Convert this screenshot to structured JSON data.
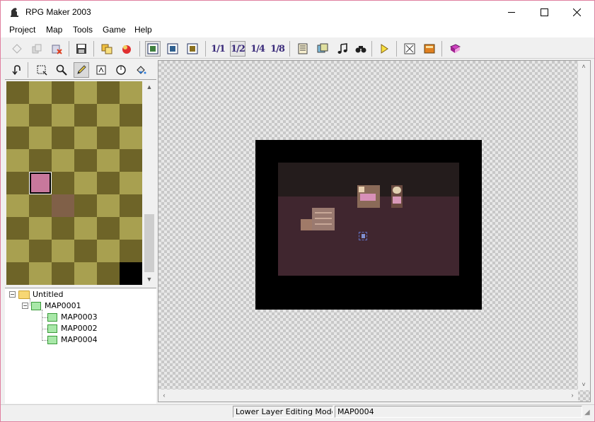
{
  "window": {
    "title": "RPG Maker 2003",
    "minimize_icon": "minimize-icon",
    "maximize_icon": "maximize-icon",
    "close_icon": "close-icon"
  },
  "menu": [
    "Project",
    "Map",
    "Tools",
    "Game",
    "Help"
  ],
  "toolbar": {
    "zoom_labels": [
      "1/1",
      "1/2",
      "1/4",
      "1/8"
    ],
    "selected_zoom": "1/2"
  },
  "palette_tools": {
    "selected_tool": "pencil"
  },
  "tree": {
    "root": "Untitled",
    "map1": "MAP0001",
    "children": [
      "MAP0003",
      "MAP0002",
      "MAP0004"
    ]
  },
  "status": {
    "mode": "Lower Layer Editing Mode",
    "map": "MAP0004"
  },
  "colors": {
    "tile_dark": "#6e6428",
    "tile_light": "#a8a050",
    "selected_tile": "#c8789c",
    "floor": "#40262f",
    "wall": "#241c1c"
  }
}
